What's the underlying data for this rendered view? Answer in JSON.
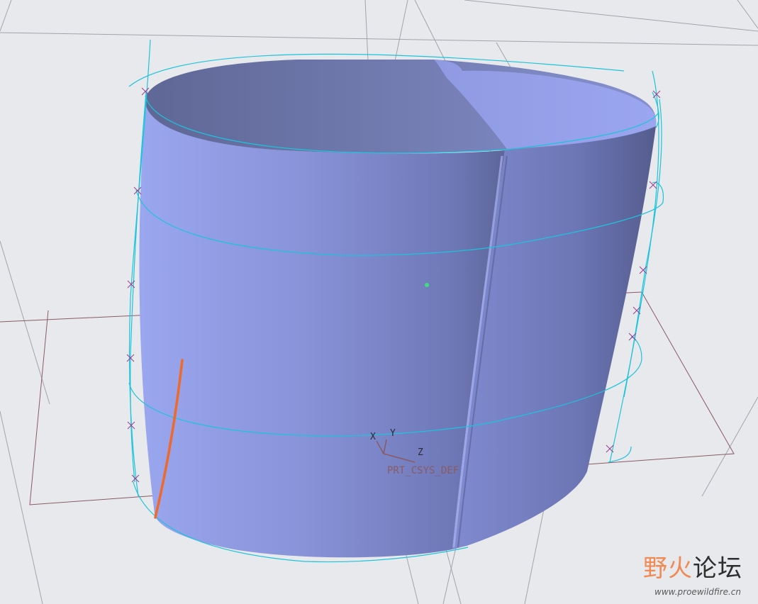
{
  "viewport": {
    "background": "#e8e9ec",
    "part_color": "#8f9ae0",
    "sketch_color": "#1cc3dc",
    "datum_color": "#8a5a63",
    "highlight_color": "#ef6a2a"
  },
  "csys": {
    "name": "PRT_CSYS_DEF",
    "x_label": "X",
    "y_label": "Y",
    "z_label": "Z"
  },
  "watermark": {
    "title_a": "野火",
    "title_b": "论坛",
    "url": "www.proewildfire.cn"
  }
}
